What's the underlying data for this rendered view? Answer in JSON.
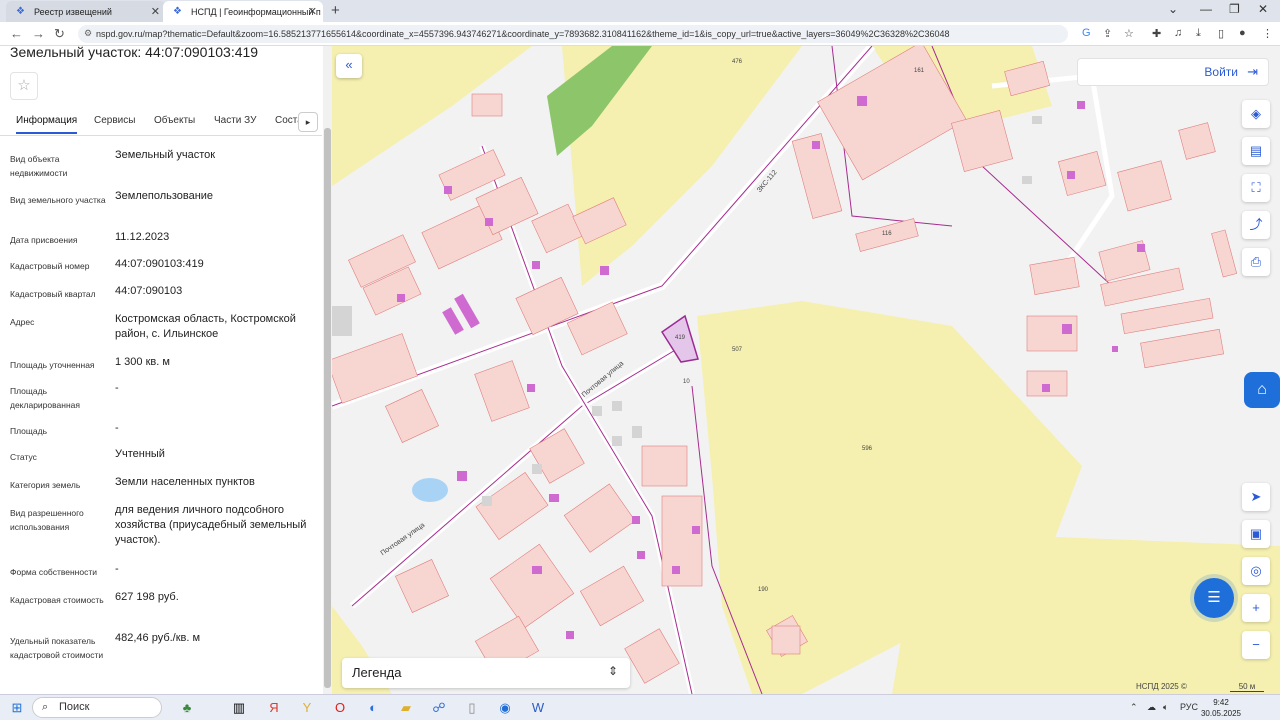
{
  "browser": {
    "tabs": [
      {
        "title": "Реестр извещений",
        "active": false
      },
      {
        "title": "НСПД | Геоинформационный п",
        "active": true
      }
    ],
    "url": "nspd.gov.ru/map?thematic=Default&zoom=16.585213771655614&coordinate_x=4557396.943746271&coordinate_y=7893682.310841162&theme_id=1&is_copy_url=true&active_layers=36049%2C36328%2C36048"
  },
  "panel": {
    "title": "Земельный участок: 44:07:090103:419",
    "tabs": [
      "Информация",
      "Сервисы",
      "Объекты",
      "Части ЗУ",
      "Соста"
    ],
    "rows": [
      {
        "label": "Вид объекта недвижимости",
        "value": "Земельный участок"
      },
      {
        "label": "Вид земельного участка",
        "value": "Землепользование"
      },
      {
        "label": "Дата присвоения",
        "value": "11.12.2023"
      },
      {
        "label": "Кадастровый номер",
        "value": "44:07:090103:419"
      },
      {
        "label": "Кадастровый квартал",
        "value": "44:07:090103"
      },
      {
        "label": "Адрес",
        "value": "Костромская область, Костромской район, с. Ильинское"
      },
      {
        "label": "Площадь уточненная",
        "value": "1 300 кв. м"
      },
      {
        "label": "Площадь декларированная",
        "value": "-"
      },
      {
        "label": "Площадь",
        "value": "-"
      },
      {
        "label": "Статус",
        "value": "Учтенный"
      },
      {
        "label": "Категория земель",
        "value": "Земли населенных пунктов"
      },
      {
        "label": "Вид разрешенного использования",
        "value": "для ведения личного подсобного хозяйства (приусадебный земельный участок)."
      },
      {
        "label": "Форма собственности",
        "value": "-"
      },
      {
        "label": "Кадастровая стоимость",
        "value": "627 198 руб."
      },
      {
        "label": "Удельный показатель кадастровой стоимости",
        "value": "482,46 руб./кв. м"
      }
    ]
  },
  "map": {
    "login_label": "Войти",
    "legend_label": "Легенда",
    "attribution": "НСПД 2025 ©",
    "scale_label": "50 м",
    "street_labels": [
      "Почтовая улица",
      "Почтовая улица",
      "ЗКС-112"
    ],
    "plot_labels": [
      "419",
      "596",
      "507",
      "476",
      "161",
      "116",
      "190",
      "10"
    ]
  },
  "taskbar": {
    "search_label": "Поиск",
    "lang": "РУС",
    "time": "9:42",
    "date": "30.05.2025"
  }
}
